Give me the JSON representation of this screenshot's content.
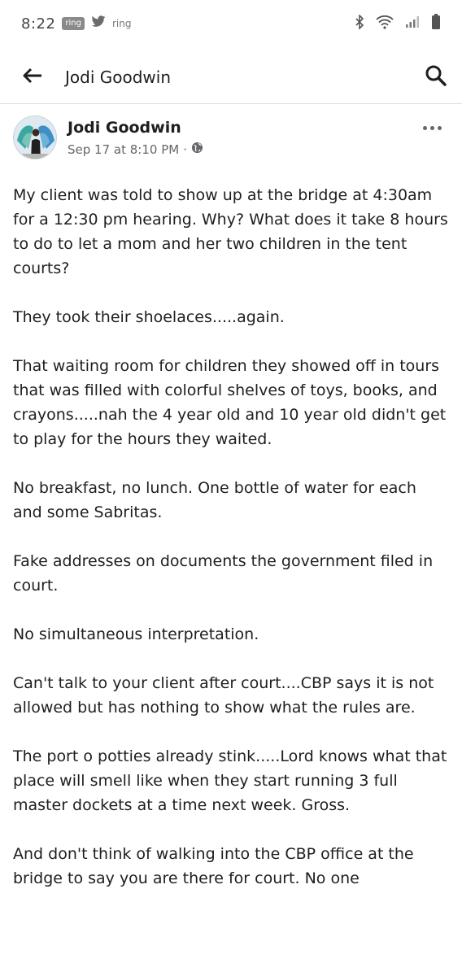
{
  "status_bar": {
    "time": "8:22",
    "badge": "ring",
    "notif_text": "ring"
  },
  "app_bar": {
    "title": "Jodi Goodwin"
  },
  "post": {
    "author": "Jodi Goodwin",
    "date": "Sep 17 at 8:10 PM",
    "separator": "·",
    "paragraphs": [
      "My client was told to show up at the bridge at 4:30am for a 12:30 pm hearing. Why? What does it take 8 hours to do to let a mom and her two children in the tent courts?",
      "They took their shoelaces.....again.",
      "That waiting room for children they showed off in tours that was filled with colorful shelves of toys, books, and crayons.....nah the 4 year old and 10 year old didn't get to play for the hours they waited.",
      "No breakfast, no lunch. One bottle of water for each and some Sabritas.",
      "Fake addresses on documents the government filed in court.",
      "No simultaneous interpretation.",
      "Can't talk to your client after court....CBP says it is not allowed but has nothing to show what the rules are.",
      "The port o potties already stink.....Lord knows what that place will smell like when they start running 3 full master dockets at a time next week. Gross.",
      "And don't think of walking into the CBP office at the bridge to say you are there for court. No one"
    ]
  },
  "colors": {
    "text": "#1c1e21",
    "meta": "#65676b",
    "divider": "#dadde1"
  }
}
